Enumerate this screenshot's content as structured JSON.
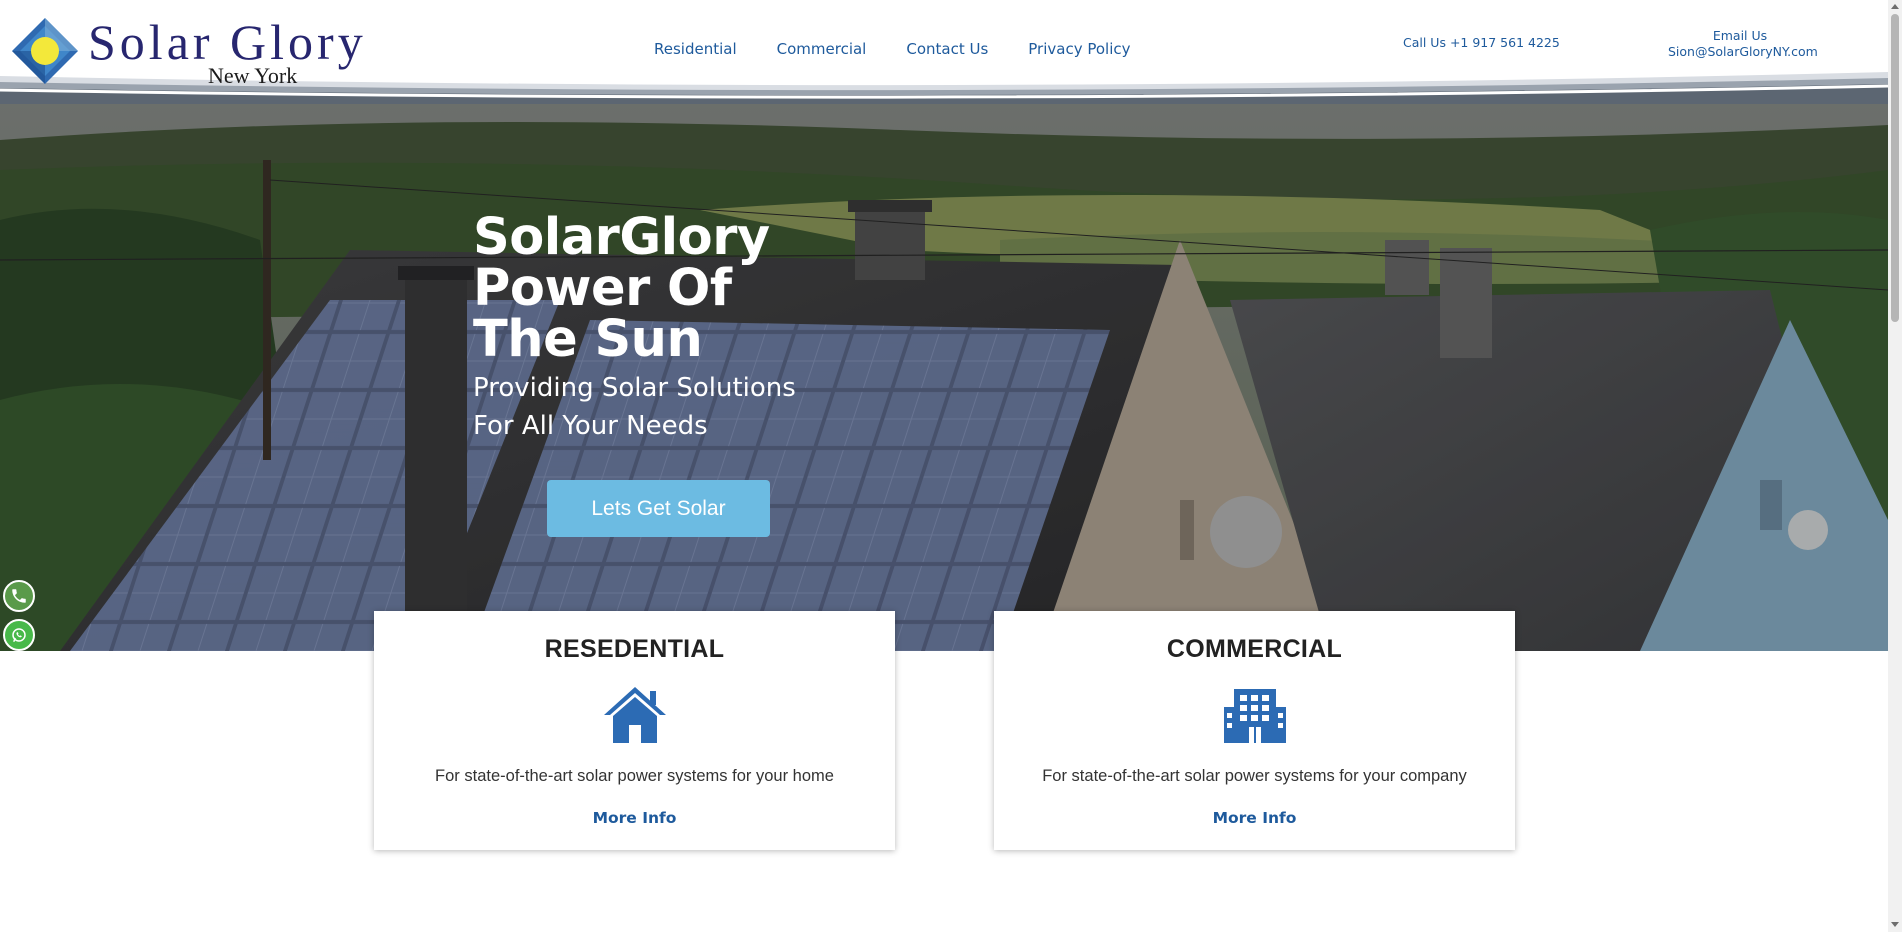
{
  "brand": {
    "name": "Solar Glory",
    "city": "New York",
    "colors": {
      "navy": "#27266f",
      "blue": "#1e5a9c",
      "accent_yellow": "#f3e83a",
      "cta": "#6cbbe2"
    }
  },
  "nav": {
    "items": [
      {
        "label": "Residential"
      },
      {
        "label": "Commercial"
      },
      {
        "label": "Contact Us"
      },
      {
        "label": "Privacy Policy"
      }
    ]
  },
  "contact": {
    "call": "Call Us +1 917 561 4225",
    "email_label": "Email Us",
    "email": "Sion@SolarGloryNY.com"
  },
  "hero": {
    "title_lines": [
      "SolarGlory",
      "Power Of",
      "The Sun"
    ],
    "subtitle_lines": [
      "Providing Solar Solutions",
      "For All Your Needs"
    ],
    "cta": "Lets Get Solar"
  },
  "floating_buttons": [
    {
      "icon": "phone-icon"
    },
    {
      "icon": "whatsapp-icon"
    }
  ],
  "cards": [
    {
      "title": "RESEDENTIAL",
      "icon": "house-icon",
      "description": "For state-of-the-art solar power systems for your home",
      "link": "More Info"
    },
    {
      "title": "COMMERCIAL",
      "icon": "building-icon",
      "description": "For state-of-the-art solar power systems for your company",
      "link": "More Info"
    }
  ]
}
